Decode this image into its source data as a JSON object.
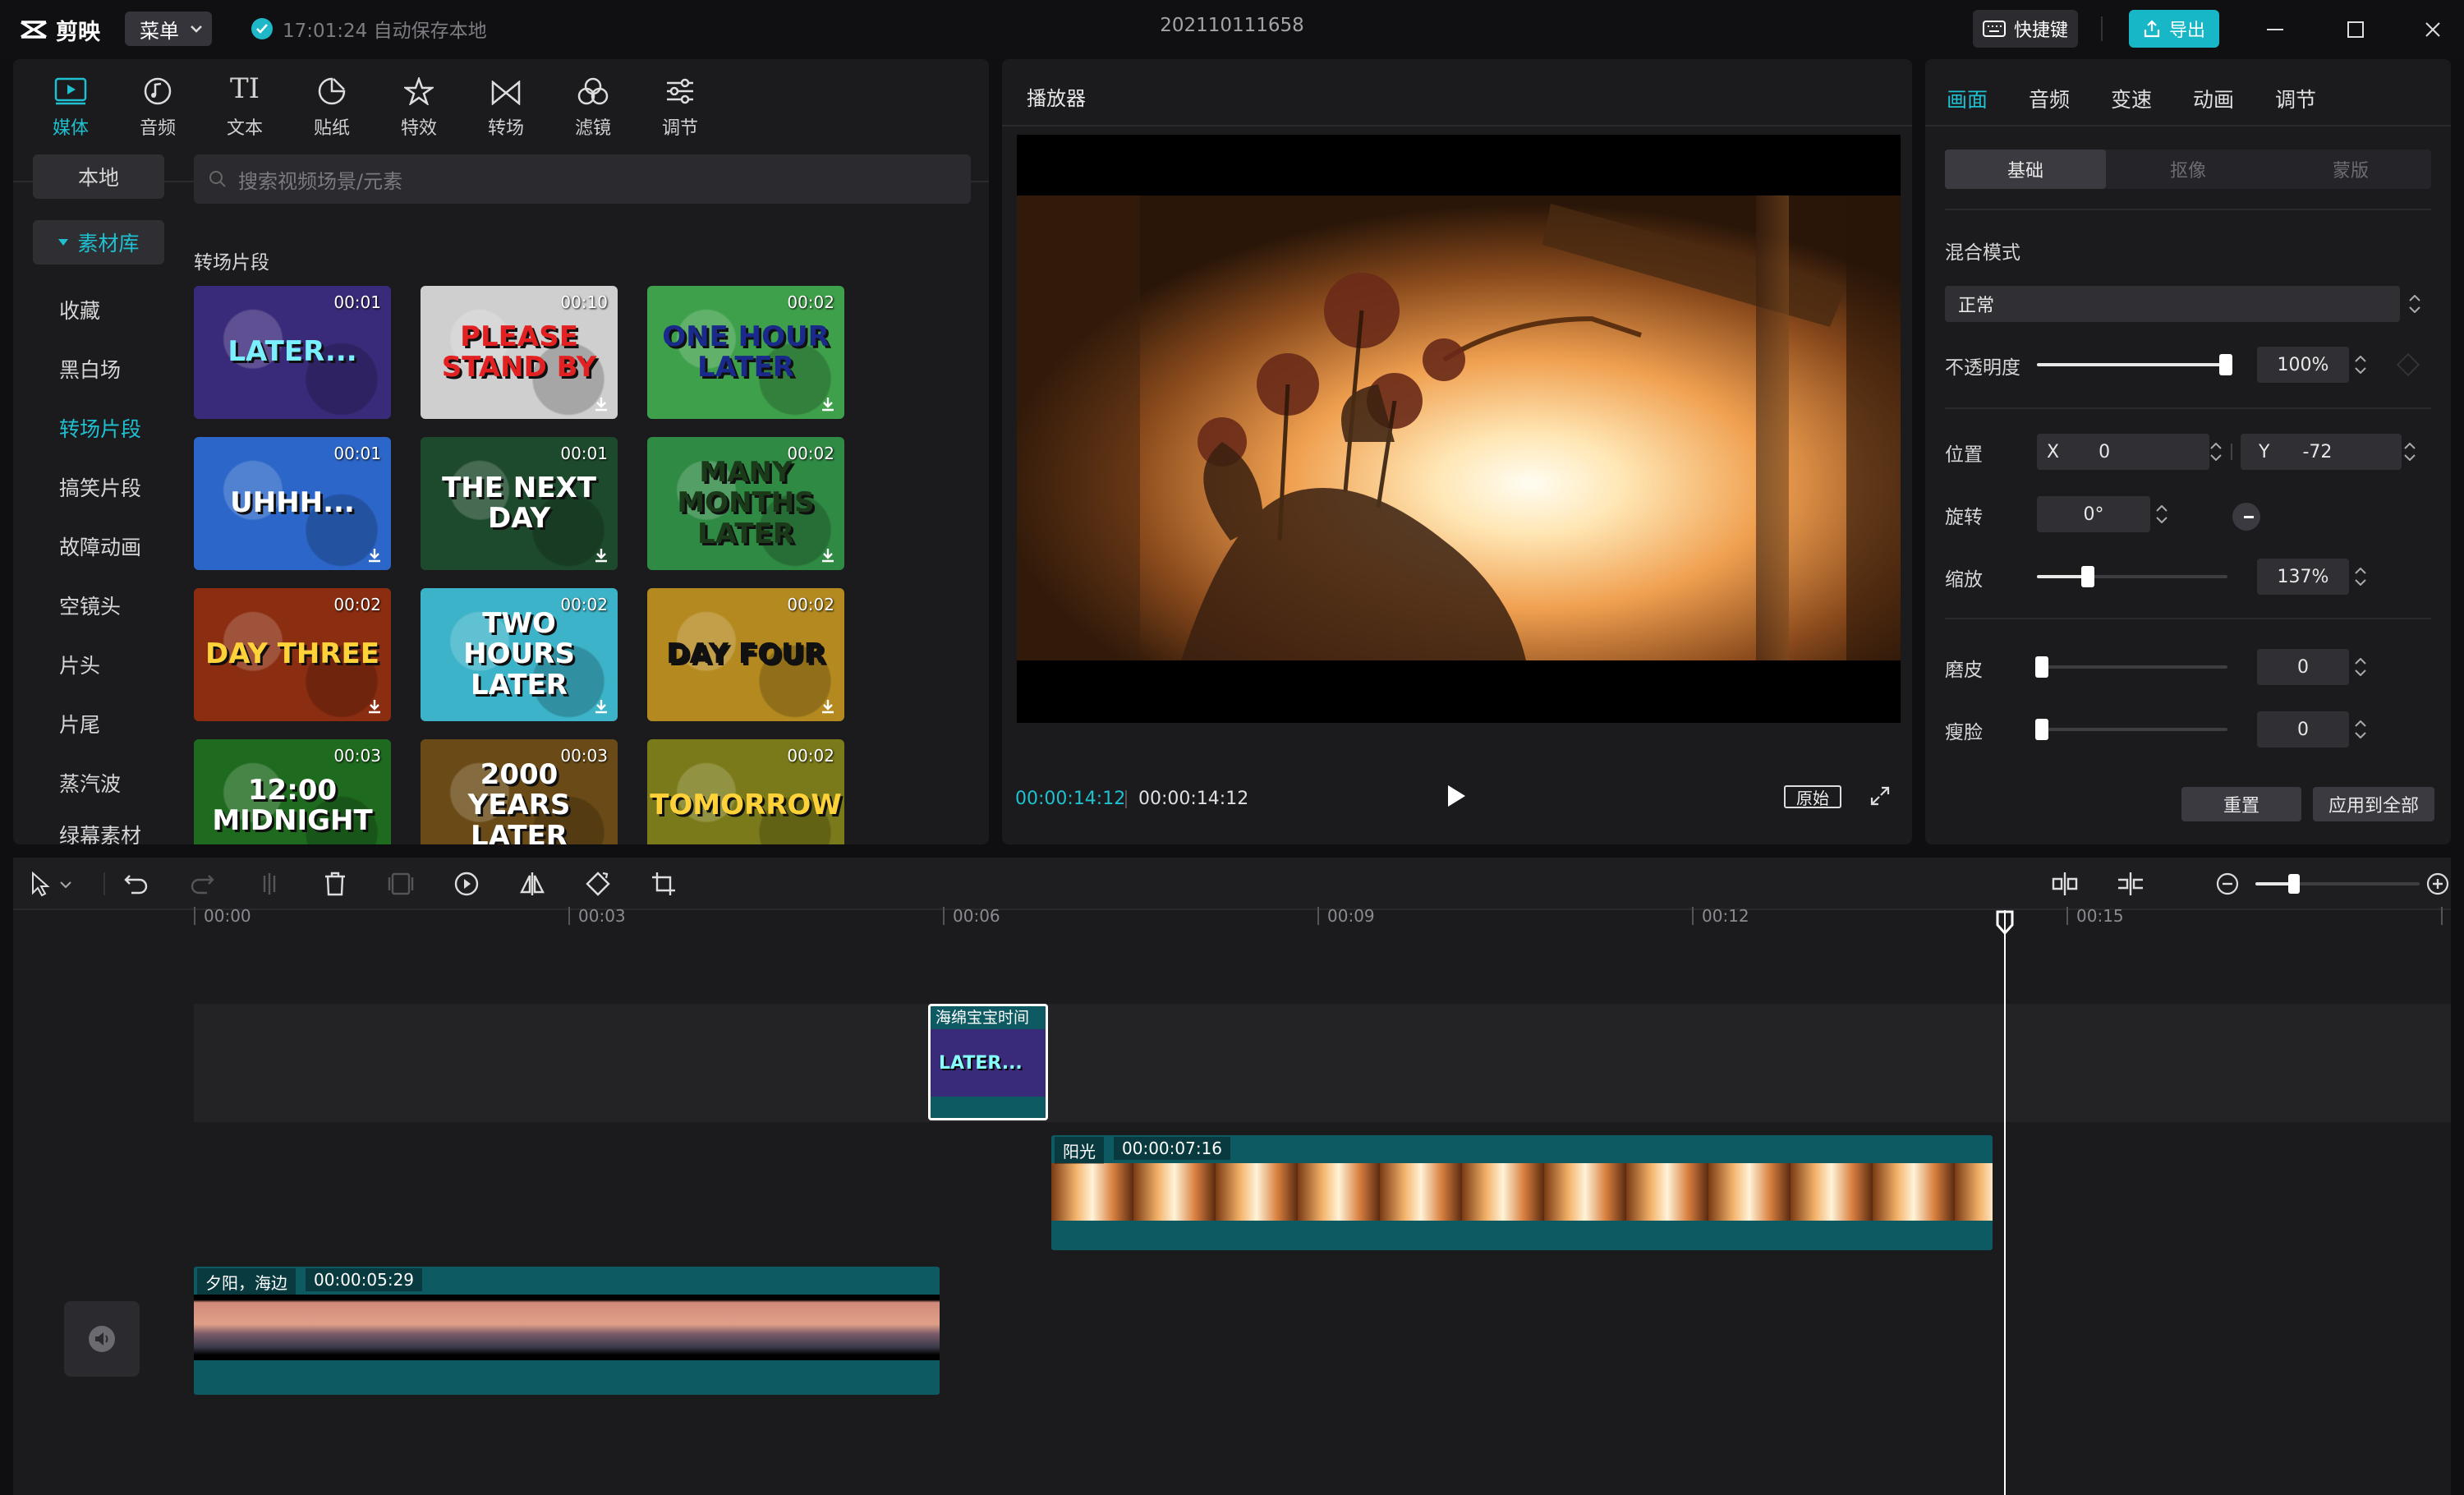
{
  "titlebar": {
    "app_name": "剪映",
    "menu_label": "菜单",
    "save_status": "17:01:24 自动保存本地",
    "project_title": "202110111658",
    "shortcut_label": "快捷键",
    "export_label": "导出"
  },
  "media": {
    "tabs": [
      "媒体",
      "音频",
      "文本",
      "贴纸",
      "特效",
      "转场",
      "滤镜",
      "调节"
    ],
    "active_tab": "媒体",
    "sidebar": [
      "本地",
      "素材库",
      "收藏",
      "黑白场",
      "转场片段",
      "搞笑片段",
      "故障动画",
      "空镜头",
      "片头",
      "片尾",
      "蒸汽波",
      "绿幕素材"
    ],
    "search_placeholder": "搜索视频场景/元素",
    "section_title": "转场片段",
    "thumbnails": [
      {
        "label": "LATER...",
        "duration": "00:01",
        "color": "#3a2a7a"
      },
      {
        "label": "PLEASE STAND BY",
        "duration": "00:10",
        "color": "#cfcfcf"
      },
      {
        "label": "ONE HOUR LATER",
        "duration": "00:02",
        "color": "#3ea04a"
      },
      {
        "label": "UHHH...",
        "duration": "00:01",
        "color": "#2b66c8"
      },
      {
        "label": "THE NEXT DAY",
        "duration": "00:01",
        "color": "#1d4a2c"
      },
      {
        "label": "MANY MONTHS LATER",
        "duration": "00:02",
        "color": "#2f8a44"
      },
      {
        "label": "DAY THREE",
        "duration": "00:02",
        "color": "#8a2d10"
      },
      {
        "label": "TWO HOURS LATER",
        "duration": "00:02",
        "color": "#3cb3c8"
      },
      {
        "label": "DAY FOUR",
        "duration": "00:02",
        "color": "#b48a20"
      },
      {
        "label": "12:00 MIDNIGHT",
        "duration": "00:03",
        "color": "#1e6a1e"
      },
      {
        "label": "2000 YEARS LATER",
        "duration": "00:03",
        "color": "#6a4a16"
      },
      {
        "label": "TOMORROW",
        "duration": "00:02",
        "color": "#7a7a1a"
      }
    ]
  },
  "player": {
    "title": "播放器",
    "current_time": "00:00:14:12",
    "total_time": "00:00:14:12",
    "original_label": "原始"
  },
  "props": {
    "tabs": [
      "画面",
      "音频",
      "变速",
      "动画",
      "调节"
    ],
    "segments": [
      "基础",
      "抠像",
      "蒙版"
    ],
    "blend_label": "混合模式",
    "blend_value": "正常",
    "opacity_label": "不透明度",
    "opacity_value": "100%",
    "opacity_level": 1.0,
    "position_label": "位置",
    "pos_x_label": "X",
    "pos_x": "0",
    "pos_y_label": "Y",
    "pos_y": "-72",
    "rotation_label": "旋转",
    "rotation_value": "0°",
    "scale_label": "缩放",
    "scale_value": "137%",
    "smooth_label": "磨皮",
    "smooth_value": "0",
    "slim_label": "瘦脸",
    "slim_value": "0",
    "reset_label": "重置",
    "apply_all_label": "应用到全部"
  },
  "timeline": {
    "ruler": [
      "00:00",
      "00:03",
      "00:06",
      "00:09",
      "00:12",
      "00:15"
    ],
    "clips": {
      "overlay_label": "海绵宝宝时间",
      "overlay_thumb": "LATER...",
      "sun_label": "阳光",
      "sun_duration": "00:00:07:16",
      "sunset_label": "夕阳，海边",
      "sunset_duration": "00:00:05:29"
    }
  },
  "colors": {
    "accent": "#1fc0d0",
    "clip_teal": "#0e5a62",
    "panel": "#1b1b1e"
  }
}
